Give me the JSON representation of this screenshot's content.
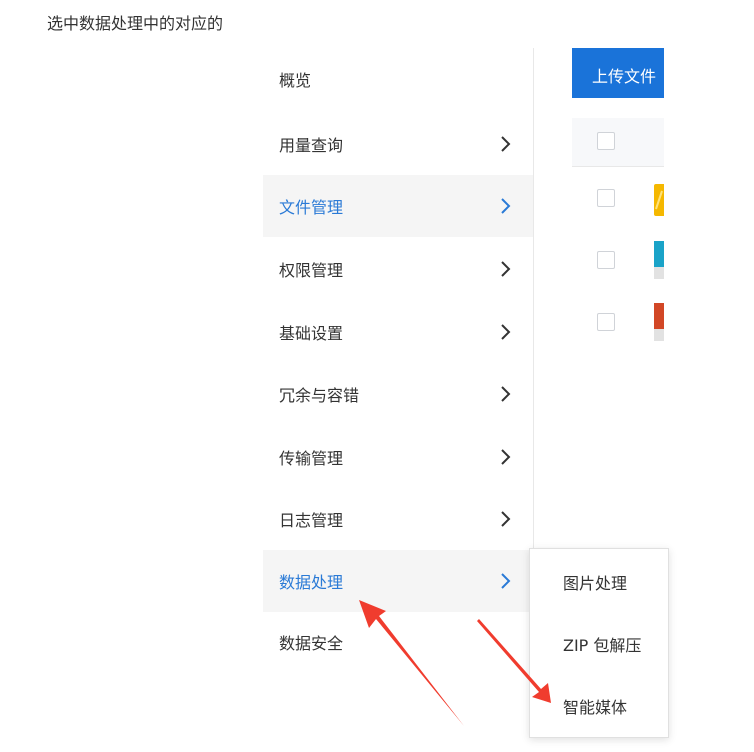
{
  "caption": "选中数据处理中的对应的",
  "sidebar": {
    "items": [
      {
        "label": "概览",
        "has_chevron": false,
        "active": false
      },
      {
        "label": "用量查询",
        "has_chevron": true,
        "active": false
      },
      {
        "label": "文件管理",
        "has_chevron": true,
        "active": true
      },
      {
        "label": "权限管理",
        "has_chevron": true,
        "active": false
      },
      {
        "label": "基础设置",
        "has_chevron": true,
        "active": false
      },
      {
        "label": "冗余与容错",
        "has_chevron": true,
        "active": false
      },
      {
        "label": "传输管理",
        "has_chevron": true,
        "active": false
      },
      {
        "label": "日志管理",
        "has_chevron": true,
        "active": false
      },
      {
        "label": "数据处理",
        "has_chevron": true,
        "active": true
      },
      {
        "label": "数据安全",
        "has_chevron": false,
        "active": false
      }
    ]
  },
  "content": {
    "upload_button_label": "上传文件",
    "file_icons": [
      "folder-icon",
      "file-icon",
      "file-icon"
    ]
  },
  "submenu": {
    "items": [
      {
        "label": "图片处理"
      },
      {
        "label": "ZIP 包解压"
      },
      {
        "label": "智能媒体"
      }
    ]
  },
  "colors": {
    "accent": "#2a7ad6",
    "primary_button": "#1a73d9",
    "annotation_arrow": "#f03c2e",
    "active_background": "#f5f5f5"
  }
}
